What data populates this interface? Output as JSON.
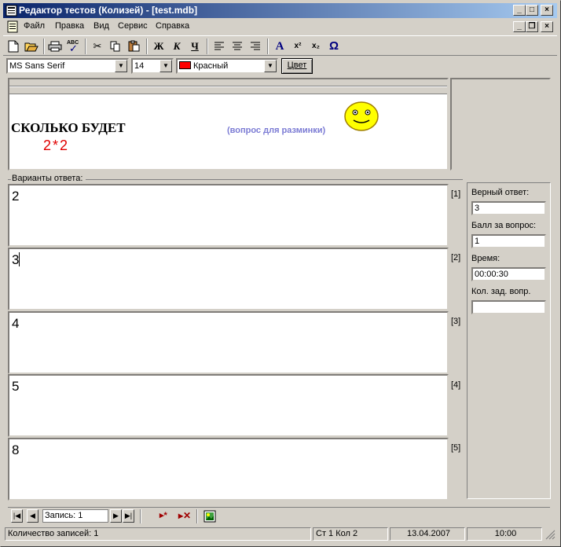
{
  "window": {
    "title": "Редактор тестов (Колизей) - [test.mdb]",
    "minimize_glyph": "_",
    "maximize_glyph": "□",
    "close_glyph": "×",
    "mdi_restore_glyph": "❐"
  },
  "menu": [
    "Файл",
    "Правка",
    "Вид",
    "Сервис",
    "Справка"
  ],
  "toolbar": {
    "bold": "Ж",
    "italic": "К",
    "underline": "Ч",
    "font_color": "A",
    "superscript": "x²",
    "subscript": "x₂",
    "symbol": "Ω",
    "spell": "ABC"
  },
  "format": {
    "font_name": "MS Sans Serif",
    "font_size": "14",
    "color_name": "Красный",
    "color_hex": "#ff0000",
    "color_button": "Цвет"
  },
  "question": {
    "text": "СКОЛЬКО БУДЕТ",
    "expression": "2*2",
    "hint": "(вопрос для разминки)"
  },
  "answers": {
    "label": "Варианты ответа:",
    "items": [
      {
        "number": "[1]",
        "text": "2"
      },
      {
        "number": "[2]",
        "text": "3"
      },
      {
        "number": "[3]",
        "text": "4"
      },
      {
        "number": "[4]",
        "text": "5"
      },
      {
        "number": "[5]",
        "text": "8"
      }
    ]
  },
  "side": {
    "correct_label": "Верный ответ:",
    "correct_value": "3",
    "score_label": "Балл за вопрос:",
    "score_value": "1",
    "time_label": "Время:",
    "time_value": "00:00:30",
    "count_label": "Кол. зад. вопр.",
    "count_value": ""
  },
  "navigator": {
    "record_text": "Запись: 1"
  },
  "status": {
    "records": "Количество записей: 1",
    "position": "Ст 1   Кол 2",
    "date": "13.04.2007",
    "time": "10:00"
  }
}
